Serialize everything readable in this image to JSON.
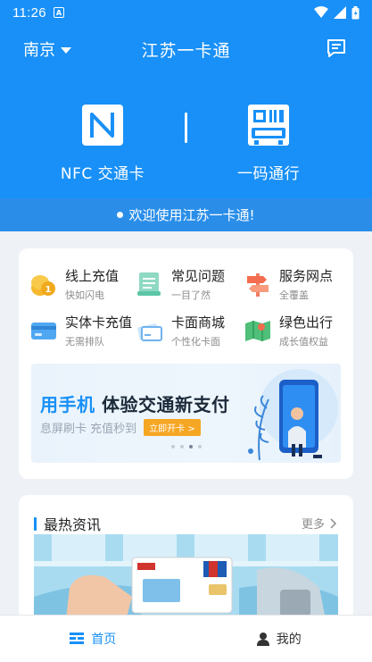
{
  "status_bar": {
    "time": "11:26",
    "notification_icon": "A"
  },
  "header": {
    "city": "南京",
    "title": "江苏一卡通",
    "message_icon": "message-icon"
  },
  "entries": {
    "nfc": {
      "label": "NFC 交通卡",
      "icon": "nfc-card-icon"
    },
    "qr": {
      "label": "一码通行",
      "icon": "qr-gate-icon"
    }
  },
  "welcome": "欢迎使用江苏一卡通!",
  "services": [
    {
      "title": "线上充值",
      "subtitle": "快如闪电",
      "icon": "coins-icon"
    },
    {
      "title": "常见问题",
      "subtitle": "一目了然",
      "icon": "document-icon"
    },
    {
      "title": "服务网点",
      "subtitle": "全覆盖",
      "icon": "signpost-icon"
    },
    {
      "title": "实体卡充值",
      "subtitle": "无需排队",
      "icon": "card-icon"
    },
    {
      "title": "卡面商城",
      "subtitle": "个性化卡面",
      "icon": "card-shop-icon"
    },
    {
      "title": "绿色出行",
      "subtitle": "成长值权益",
      "icon": "map-icon"
    }
  ],
  "banner": {
    "headline_highlight": "用手机",
    "headline_rest": " 体验交通新支付",
    "subtitle": "息屏刷卡 充值秒到",
    "button": "立即开卡 >",
    "active_dot": 2,
    "dot_count": 4
  },
  "news": {
    "title": "最热资讯",
    "more": "更多"
  },
  "tabbar": {
    "home": "首页",
    "me": "我的"
  },
  "colors": {
    "primary": "#1890f7",
    "accent": "#f5a623"
  }
}
